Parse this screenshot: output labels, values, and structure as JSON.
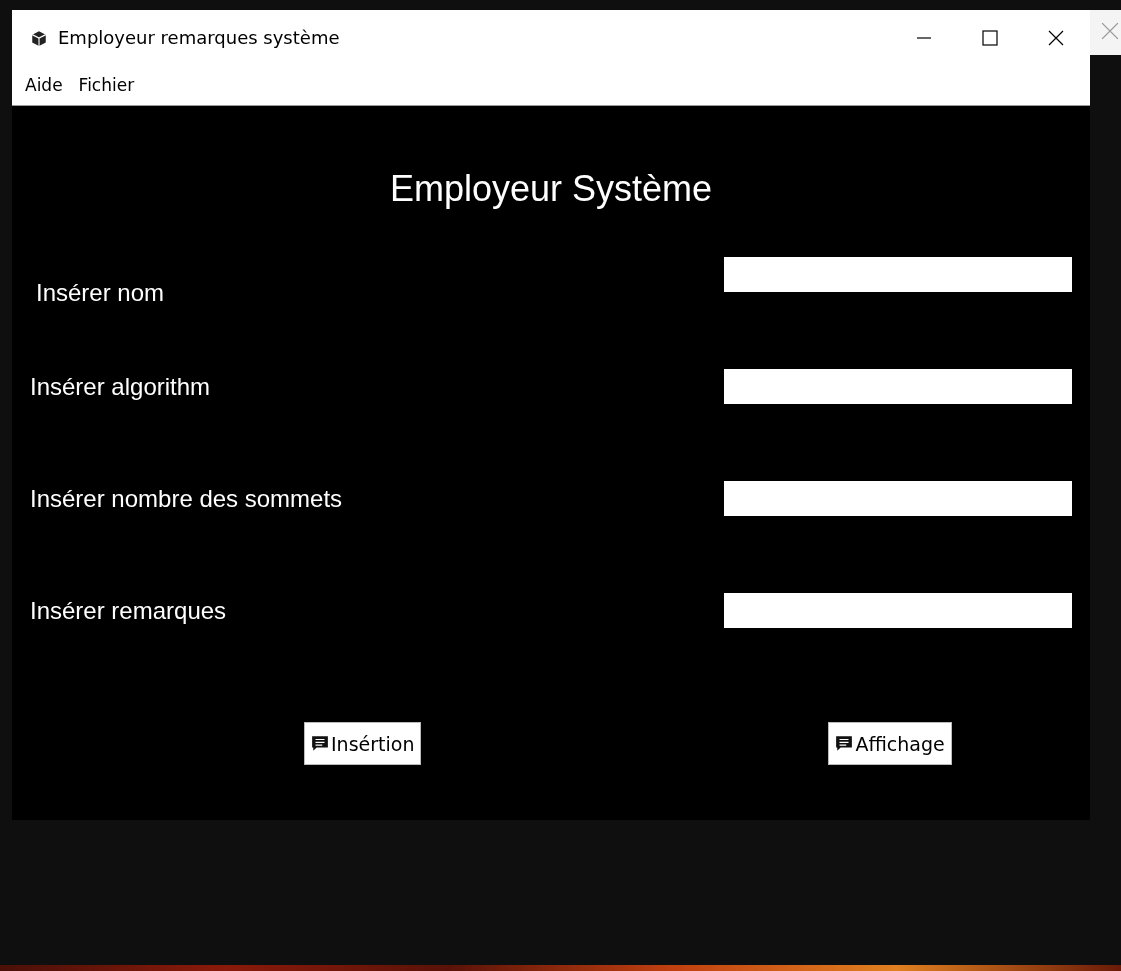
{
  "window": {
    "title": "Employeur remarques système"
  },
  "menu": [
    "Aide",
    "Fichier"
  ],
  "heading": "Employeur Système",
  "fields": [
    {
      "label": "Insérer nom"
    },
    {
      "label": "Insérer algorithm"
    },
    {
      "label": "Insérer nombre des sommets"
    },
    {
      "label": "Insérer remarques"
    }
  ],
  "buttons": [
    "Insértion",
    "Affichage"
  ]
}
